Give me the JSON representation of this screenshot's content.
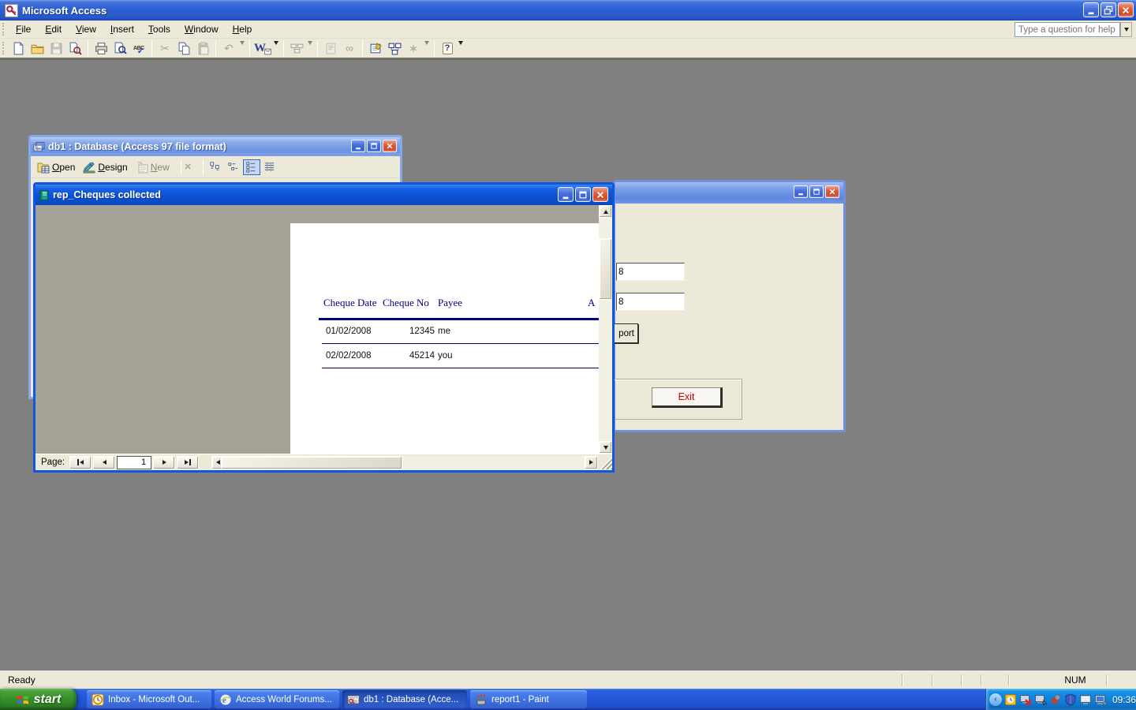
{
  "app": {
    "title": "Microsoft Access"
  },
  "menubar": {
    "items": [
      "File",
      "Edit",
      "View",
      "Insert",
      "Tools",
      "Window",
      "Help"
    ],
    "question_placeholder": "Type a question for help"
  },
  "toolbar": {
    "glyphs": {
      "cut": "✂",
      "undo": "↶",
      "spelling": "ABC",
      "check": "✓",
      "officelinks": "W",
      "link": "∞",
      "newobject": "∗",
      "help": "?",
      "dropdown": "▾"
    },
    "icon_names": [
      "new-file",
      "open",
      "save",
      "file-search",
      "print",
      "print-preview",
      "spelling",
      "cut",
      "copy",
      "paste",
      "undo",
      "officelinks-word",
      "analyze",
      "code",
      "link",
      "properties",
      "relationships",
      "new-object",
      "help"
    ]
  },
  "db_window": {
    "title": "db1 : Database (Access 97 file format)",
    "buttons": {
      "open": "Open",
      "design": "Design",
      "new": "New",
      "delete": "×"
    },
    "view_icons": [
      "large-icons",
      "small-icons",
      "list",
      "details"
    ]
  },
  "report_window": {
    "title": "rep_Cheques collected",
    "columns": {
      "date": "Cheque Date",
      "no": "Cheque No",
      "payee": "Payee",
      "amount": "A"
    },
    "rows": [
      {
        "date": "01/02/2008",
        "no": "12345",
        "payee": "me"
      },
      {
        "date": "02/02/2008",
        "no": "45214",
        "payee": "you"
      }
    ],
    "nav": {
      "label": "Page:",
      "page": "1"
    }
  },
  "form_window": {
    "field1_visible_text": "8",
    "field2_visible_text": "8",
    "report_button_visible_text": "port",
    "exit_label": "Exit"
  },
  "statusbar": {
    "left": "Ready",
    "num": "NUM"
  },
  "taskbar": {
    "start_label": "start",
    "tasks": [
      "Inbox - Microsoft Out...",
      "Access World Forums...",
      "db1 : Database (Acce...",
      "report1 - Paint"
    ],
    "tray_icon_names": [
      "collapse-chevron",
      "reminder-clock",
      "display-error",
      "remote-desktop",
      "volume-blocked",
      "firewall-shield",
      "display",
      "computer"
    ],
    "clock": "09:36"
  }
}
